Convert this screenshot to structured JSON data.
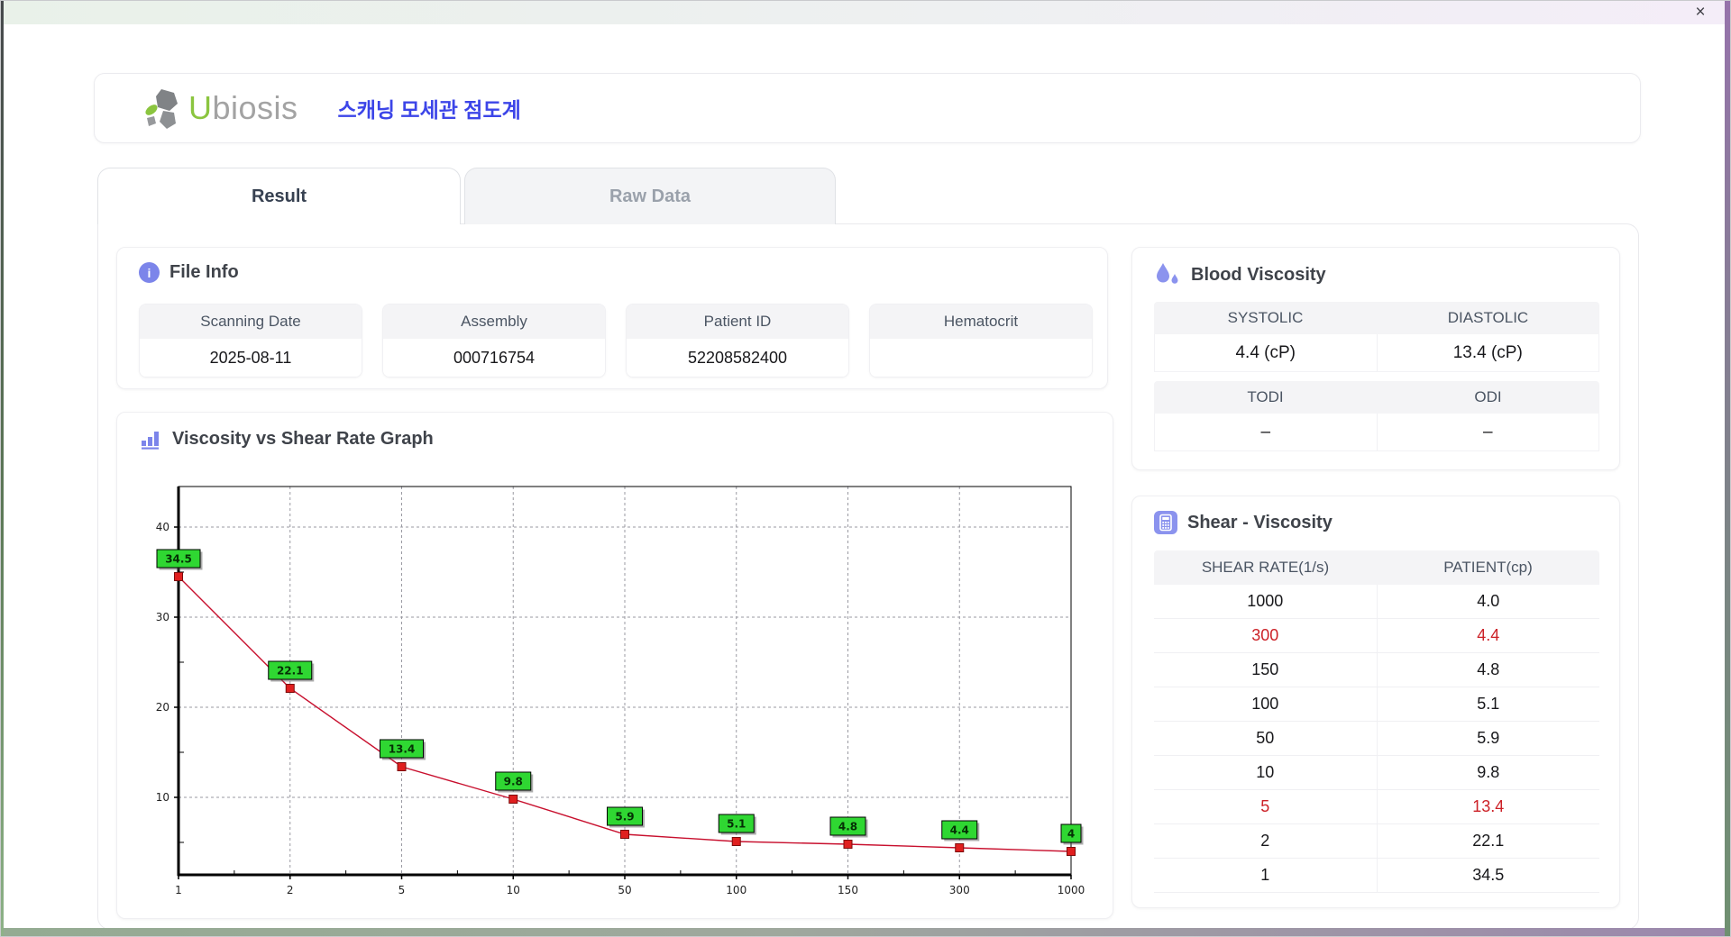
{
  "window": {
    "close_glyph": "×"
  },
  "header": {
    "logo_u": "U",
    "logo_rest": "biosis",
    "title_ko": "스캐닝 모세관 점도계"
  },
  "tabs": [
    {
      "label": "Result",
      "active": true
    },
    {
      "label": "Raw Data",
      "active": false
    }
  ],
  "file_info": {
    "title": "File Info",
    "fields": [
      {
        "label": "Scanning Date",
        "value": "2025-08-11"
      },
      {
        "label": "Assembly",
        "value": "000716754"
      },
      {
        "label": "Patient ID",
        "value": "52208582400"
      },
      {
        "label": "Hematocrit",
        "value": ""
      }
    ]
  },
  "blood_viscosity": {
    "title": "Blood Viscosity",
    "pairs": [
      {
        "label_left": "SYSTOLIC",
        "label_right": "DIASTOLIC",
        "value_left": "4.4 (cP)",
        "value_right": "13.4 (cP)"
      },
      {
        "label_left": "TODI",
        "label_right": "ODI",
        "value_left": "–",
        "value_right": "–"
      }
    ]
  },
  "graph": {
    "title": "Viscosity vs Shear Rate Graph"
  },
  "chart_data": {
    "type": "line",
    "title": "Viscosity vs Shear Rate Graph",
    "categories": [
      "1",
      "2",
      "5",
      "10",
      "50",
      "100",
      "150",
      "300",
      "1000"
    ],
    "values": [
      34.5,
      22.1,
      13.4,
      9.8,
      5.9,
      5.1,
      4.8,
      4.4,
      4.0
    ],
    "point_labels": [
      "34.5",
      "22.1",
      "13.4",
      "9.8",
      "5.9",
      "5.1",
      "4.8",
      "4.4",
      "4"
    ],
    "yticks": [
      10,
      20,
      30,
      40
    ],
    "ylim": [
      0,
      44.5
    ],
    "xlabel": "",
    "ylabel": "",
    "x_scale": "categorical-equal-spacing",
    "grid": true,
    "legend": "none",
    "line_color": "#c8102e",
    "marker_color": "#e01f1f",
    "label_bg": "#2fd732"
  },
  "shear_viscosity": {
    "title": "Shear - Viscosity",
    "columns": [
      "SHEAR RATE(1/s)",
      "PATIENT(cp)"
    ],
    "rows": [
      {
        "shear": "1000",
        "patient": "4.0",
        "highlight": false
      },
      {
        "shear": "300",
        "patient": "4.4",
        "highlight": true
      },
      {
        "shear": "150",
        "patient": "4.8",
        "highlight": false
      },
      {
        "shear": "100",
        "patient": "5.1",
        "highlight": false
      },
      {
        "shear": "50",
        "patient": "5.9",
        "highlight": false
      },
      {
        "shear": "10",
        "patient": "9.8",
        "highlight": false
      },
      {
        "shear": "5",
        "patient": "13.4",
        "highlight": true
      },
      {
        "shear": "2",
        "patient": "22.1",
        "highlight": false
      },
      {
        "shear": "1",
        "patient": "34.5",
        "highlight": false
      }
    ]
  },
  "colors": {
    "title_blue": "#3c45e8",
    "logo_green": "#8bc53f",
    "logo_gray": "#a3a3a3",
    "accent_purple": "#8b93ee",
    "highlight_red": "#cc2127",
    "header_bg": "#f4f4f6"
  }
}
